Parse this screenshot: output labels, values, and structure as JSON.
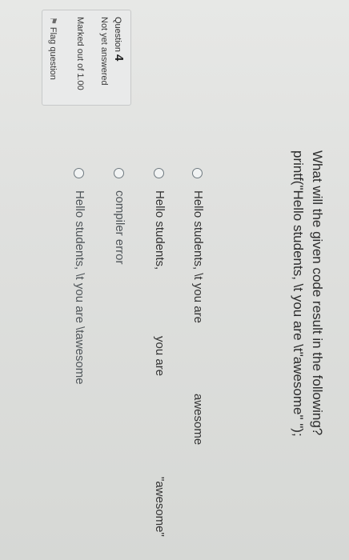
{
  "question_info": {
    "number_prefix": "Question",
    "number": "4",
    "state": "Not yet answered",
    "marks": "Marked out of 1.00",
    "flag_label": "Flag question",
    "flag_icon": "flag-icon"
  },
  "question": {
    "line1": "What will the given code result in the following?",
    "line2": "printf(\"Hello students, \\t you are \\t\"awesome\" \");"
  },
  "options": [
    {
      "a": "Hello students, \\t you are",
      "b": "awesome"
    },
    {
      "a": "Hello students,",
      "b": "you are",
      "c": "\"awesome\""
    },
    {
      "a": "compiler error"
    },
    {
      "a": "Hello students, \\t you are \\tawesome"
    }
  ]
}
